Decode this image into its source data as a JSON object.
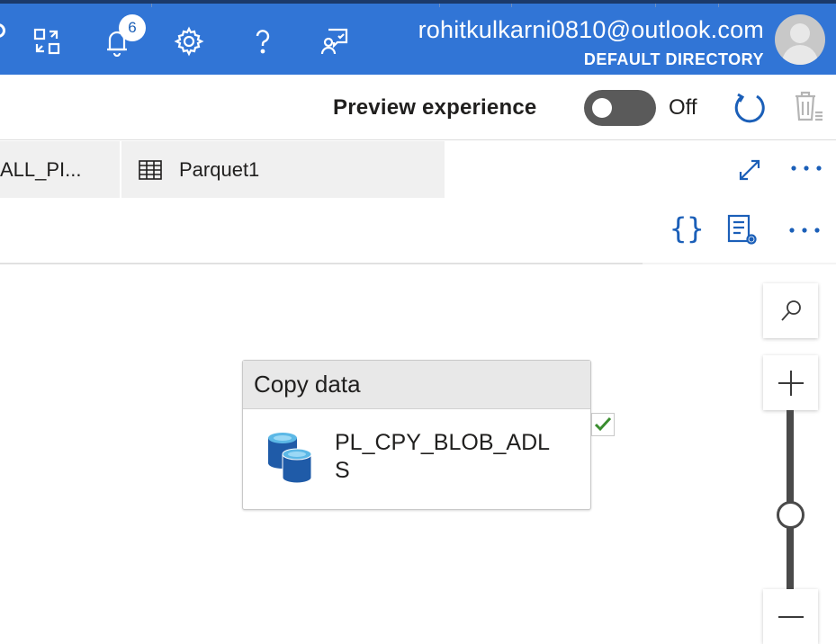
{
  "header": {
    "notifications_count": "6",
    "user_email": "rohitkulkarni0810@outlook.com",
    "directory": "DEFAULT DIRECTORY",
    "icons": [
      "portal-switch-icon",
      "bell-icon",
      "gear-icon",
      "help-icon",
      "feedback-icon"
    ]
  },
  "preview": {
    "label": "Preview experience",
    "toggle_state": "Off"
  },
  "tabs": [
    {
      "label": "ALL_PI...",
      "icon": "pipeline-icon"
    },
    {
      "label": "Parquet1",
      "icon": "table-icon"
    }
  ],
  "toolbar": {
    "code_label": "{}"
  },
  "activity": {
    "type_label": "Copy data",
    "name": "PL_CPY_BLOB_ADLS",
    "icon": "database-icon",
    "status": "success"
  },
  "zoom": {
    "level": 0.5
  },
  "colors": {
    "topbar": "#3175d6",
    "accent": "#1b5fb8",
    "success": "#3a8d2f"
  }
}
